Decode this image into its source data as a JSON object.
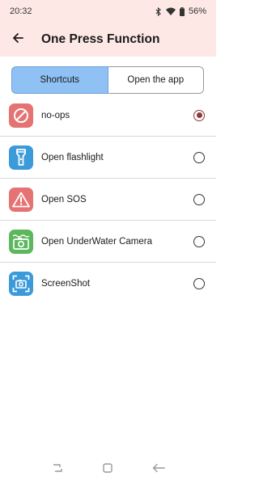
{
  "status": {
    "time": "20:32",
    "battery": "56%"
  },
  "header": {
    "title": "One Press Function"
  },
  "tabs": [
    {
      "label": "Shortcuts",
      "active": true
    },
    {
      "label": "Open the app",
      "active": false
    }
  ],
  "options": [
    {
      "label": "no-ops",
      "icon": "no-entry-icon",
      "color": "#e57373",
      "selected": true
    },
    {
      "label": "Open flashlight",
      "icon": "flashlight-icon",
      "color": "#3b9ad9",
      "selected": false
    },
    {
      "label": "Open SOS",
      "icon": "warning-icon",
      "color": "#e57373",
      "selected": false
    },
    {
      "label": "Open UnderWater Camera",
      "icon": "underwater-camera-icon",
      "color": "#5cb85c",
      "selected": false
    },
    {
      "label": "ScreenShot",
      "icon": "screenshot-icon",
      "color": "#3b9ad9",
      "selected": false
    }
  ]
}
